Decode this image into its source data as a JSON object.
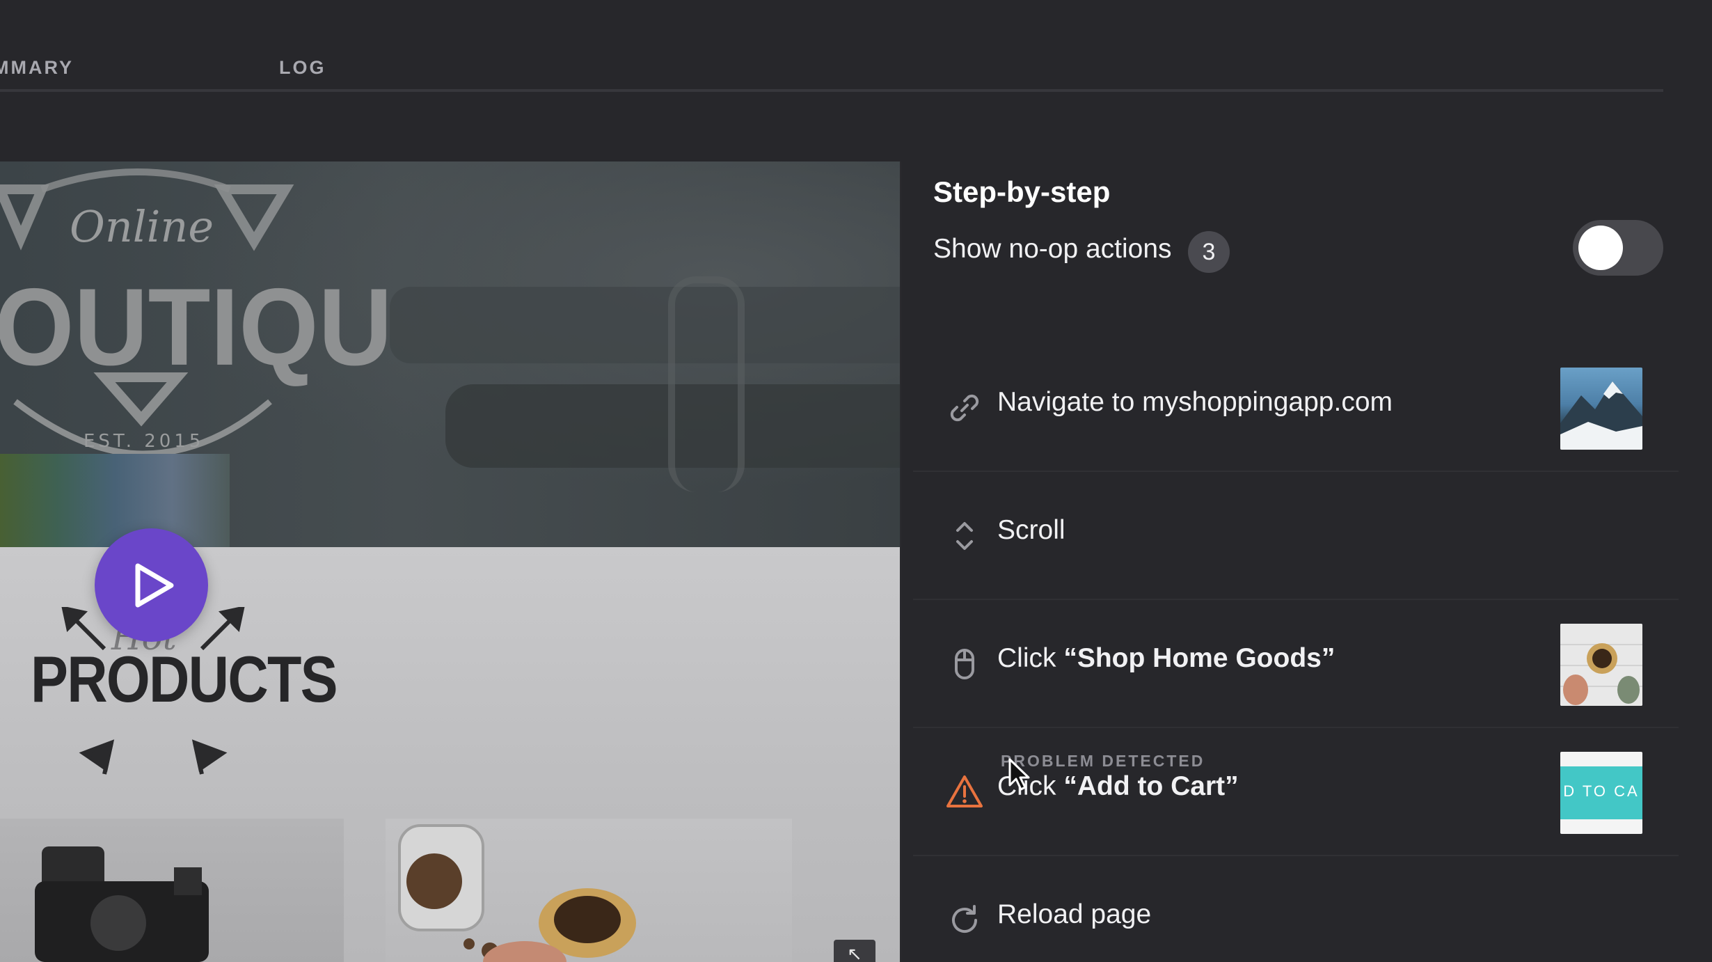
{
  "tabs": [
    {
      "label": "MMARY"
    },
    {
      "label": "LOG"
    }
  ],
  "preview": {
    "logo_script": "Online",
    "logo_word": "OUTIQUE",
    "logo_est": "EST. 2015",
    "hot_word": "Hot",
    "products_word": "PRODUCTS",
    "expand_glyph": "↖",
    "play_icon": "play-icon"
  },
  "panel": {
    "title": "Step-by-step",
    "noop_label": "Show no-op actions",
    "noop_count": "3",
    "toggle_on": false
  },
  "steps": [
    {
      "icon": "link-icon",
      "prefix": "Navigate to myshoppingapp.com",
      "bold": "",
      "thumbnail": "mountain"
    },
    {
      "icon": "scroll-icon",
      "prefix": "Scroll",
      "bold": "",
      "thumbnail": ""
    },
    {
      "icon": "mouse-icon",
      "prefix": "Click ",
      "bold": "“Shop Home Goods”",
      "thumbnail": "home-goods"
    },
    {
      "icon": "warning-icon",
      "problem": "PROBLEM DETECTED",
      "prefix": "Click ",
      "bold": "“Add to Cart”",
      "thumbnail": "add-to-cart",
      "thumbnail_text": "D TO CA"
    },
    {
      "icon": "reload-icon",
      "prefix": "Reload page",
      "bold": "",
      "thumbnail": ""
    }
  ],
  "colors": {
    "background": "#27272b",
    "accent_play": "#6a46c9",
    "warning": "#e8733f",
    "cart_teal": "#43c7c6"
  }
}
